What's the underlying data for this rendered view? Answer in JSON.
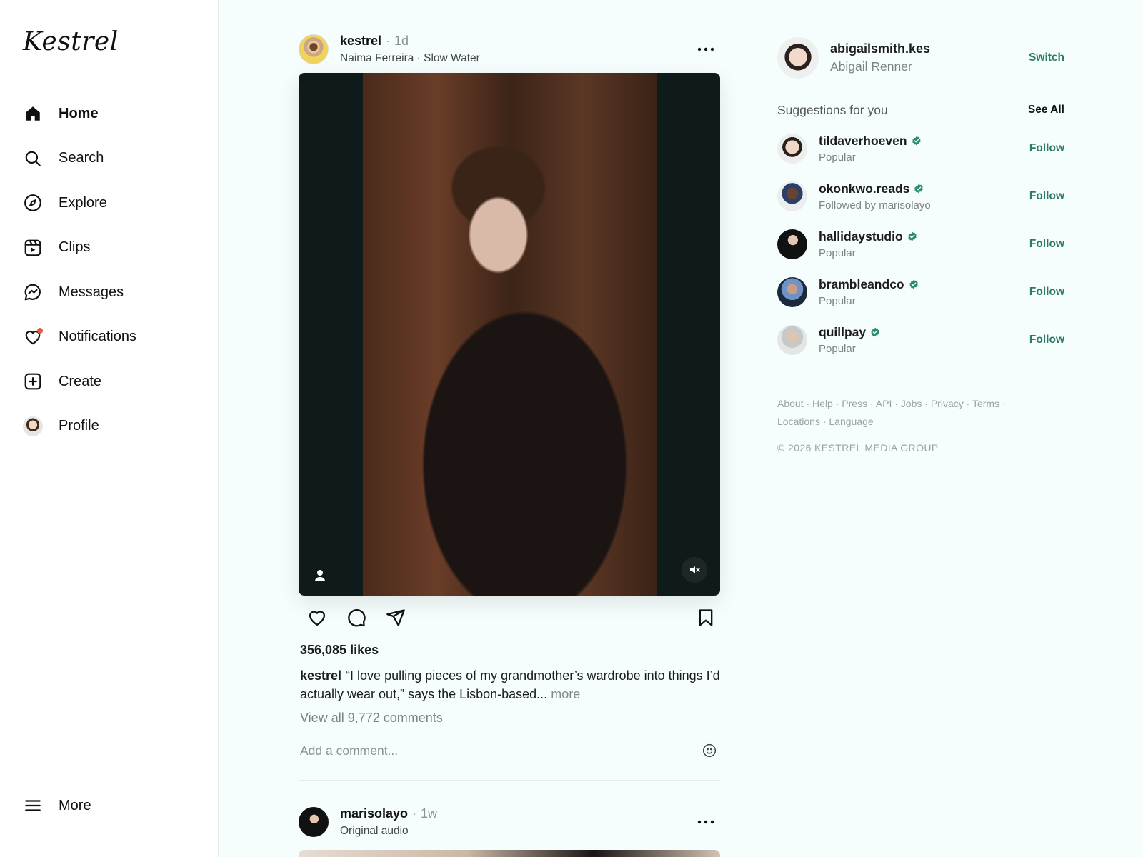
{
  "app": {
    "logo_text": "Kestrel"
  },
  "sidebar": {
    "items": [
      {
        "label": "Home",
        "icon": "home-icon",
        "active": true
      },
      {
        "label": "Search",
        "icon": "search-icon"
      },
      {
        "label": "Explore",
        "icon": "compass-icon"
      },
      {
        "label": "Clips",
        "icon": "clips-icon"
      },
      {
        "label": "Messages",
        "icon": "messenger-icon"
      },
      {
        "label": "Notifications",
        "icon": "heart-icon",
        "has_dot": true
      },
      {
        "label": "Create",
        "icon": "plus-square-icon"
      },
      {
        "label": "Profile",
        "icon": "avatar"
      }
    ],
    "more_label": "More"
  },
  "post1": {
    "username": "kestrel",
    "time": "1d",
    "subtitle": "Naima Ferreira · Slow Water",
    "likes": "356,085 likes",
    "caption_user": "kestrel",
    "caption_text": "“I love pulling pieces of my grandmother’s wardrobe into things I’d actually wear out,” says the Lisbon-based...",
    "more_label": "more",
    "view_comments": "View all 9,772 comments",
    "comment_placeholder": "Add a comment..."
  },
  "post2": {
    "username": "marisolayo",
    "time": "1w",
    "subtitle": "Original audio"
  },
  "rail": {
    "me": {
      "username": "abigailsmith.kes",
      "name": "Abigail Renner",
      "switch_label": "Switch"
    },
    "suggestions_title": "Suggestions for you",
    "see_all_label": "See All",
    "suggestions": [
      {
        "username": "tildaverhoeven",
        "subtitle": "Popular",
        "verified": true,
        "action": "Follow"
      },
      {
        "username": "okonkwo.reads",
        "subtitle": "Followed by marisolayo",
        "verified": true,
        "action": "Follow"
      },
      {
        "username": "hallidaystudio",
        "subtitle": "Popular",
        "verified": true,
        "action": "Follow"
      },
      {
        "username": "brambleandco",
        "subtitle": "Popular",
        "verified": true,
        "action": "Follow"
      },
      {
        "username": "quillpay",
        "subtitle": "Popular",
        "verified": true,
        "action": "Follow"
      }
    ],
    "footer_links": [
      "About",
      "Help",
      "Press",
      "API",
      "Jobs",
      "Privacy",
      "Terms",
      "Locations",
      "Language"
    ],
    "copyright": "© 2026 KESTREL MEDIA GROUP"
  },
  "colors": {
    "background": "#f5fdfd",
    "accent": "#2d7a6a",
    "notification_dot": "#e85a3c",
    "verified_badge": "#2d8a72"
  }
}
